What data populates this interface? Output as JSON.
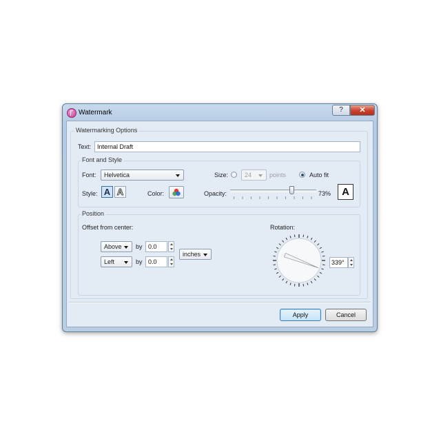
{
  "window": {
    "title": "Watermark",
    "help_label": "?",
    "close_label": "✕"
  },
  "options": {
    "group_title": "Watermarking Options",
    "text_label": "Text:",
    "text_value": "Internal Draft"
  },
  "font_style": {
    "group_title": "Font and Style",
    "font_label": "Font:",
    "font_value": "Helvetica",
    "size_label": "Size:",
    "size_value": "24",
    "points_label": "points",
    "auto_fit_label": "Auto fit",
    "auto_fit_selected": true,
    "style_label": "Style:",
    "style_filled_glyph": "A",
    "style_outline_glyph": "A",
    "color_label": "Color:",
    "opacity_label": "Opacity:",
    "opacity_percent": 73,
    "opacity_text": "73%",
    "preview_glyph": "A"
  },
  "position": {
    "group_title": "Position",
    "offset_label": "Offset from center:",
    "vertical_value": "Above",
    "horizontal_value": "Left",
    "by_label": "by",
    "vertical_amount": "0.0",
    "horizontal_amount": "0.0",
    "units_value": "inches",
    "rotation_label": "Rotation:",
    "rotation_degrees": 339,
    "rotation_text": "339°"
  },
  "buttons": {
    "apply_label": "Apply",
    "cancel_label": "Cancel"
  },
  "colors": {
    "accent": "#3c7fb1",
    "close_red": "#c8402c"
  },
  "icons": [
    "watermark-app-icon",
    "help-icon",
    "close-icon",
    "color-picker-icon",
    "dropdown-arrow-icon",
    "spin-arrows-icon"
  ]
}
